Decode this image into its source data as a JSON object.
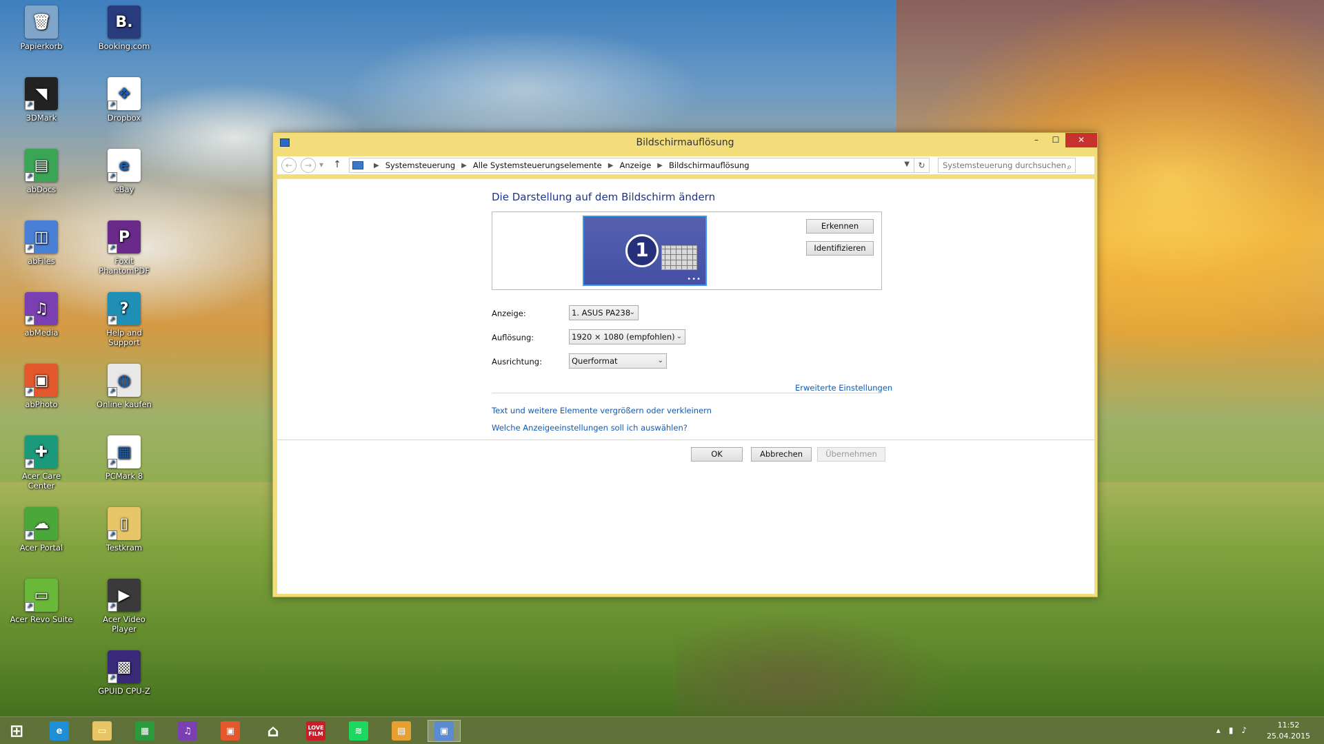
{
  "desktop": {
    "icons": [
      {
        "label": "Papierkorb",
        "icon": "recycle-bin-icon",
        "color": "#7fa5c8"
      },
      {
        "label": "Booking.com",
        "icon": "booking-icon",
        "color": "#273b7d"
      },
      {
        "label": "3DMark",
        "icon": "3dmark-icon",
        "color": "#222222"
      },
      {
        "label": "Dropbox",
        "icon": "dropbox-icon",
        "color": "#ffffff"
      },
      {
        "label": "abDocs",
        "icon": "abdocs-icon",
        "color": "#3aa655"
      },
      {
        "label": "eBay",
        "icon": "ebay-icon",
        "color": "#ffffff"
      },
      {
        "label": "abFiles",
        "icon": "abfiles-icon",
        "color": "#4a7fd6"
      },
      {
        "label": "Foxit PhantomPDF",
        "icon": "foxit-icon",
        "color": "#6a2a8a"
      },
      {
        "label": "abMedia",
        "icon": "abmedia-icon",
        "color": "#7a3fb0"
      },
      {
        "label": "Help and Support",
        "icon": "help-icon",
        "color": "#1f8fb5"
      },
      {
        "label": "abPhoto",
        "icon": "abphoto-icon",
        "color": "#e2572b"
      },
      {
        "label": "Online kaufen",
        "icon": "acer-store-icon",
        "color": "#e8e8e8"
      },
      {
        "label": "Acer Care Center",
        "icon": "care-center-icon",
        "color": "#1a9a7a"
      },
      {
        "label": "PCMark 8",
        "icon": "pcmark-icon",
        "color": "#ffffff"
      },
      {
        "label": "Acer Portal",
        "icon": "acer-portal-icon",
        "color": "#4aa83a"
      },
      {
        "label": "Testkram",
        "icon": "folder-icon",
        "color": "#e8c668"
      },
      {
        "label": "Acer Revo Suite",
        "icon": "revo-suite-icon",
        "color": "#6ab83a"
      },
      {
        "label": "Acer Video Player",
        "icon": "video-player-icon",
        "color": "#3a3a3a"
      },
      {
        "label": "GPUID CPU-Z",
        "icon": "cpuz-icon",
        "color": "#3a2a7a"
      }
    ]
  },
  "window": {
    "title": "Bildschirmauflösung",
    "controls": {
      "minimize": "–",
      "maximize": "☐",
      "close": "✕"
    },
    "address": {
      "crumbs": [
        "Systemsteuerung",
        "Alle Systemsteuerungselemente",
        "Anzeige",
        "Bildschirmauflösung"
      ],
      "search_placeholder": "Systemsteuerung durchsuchen"
    },
    "heading": "Die Darstellung auf dem Bildschirm ändern",
    "monitor_number": "1",
    "buttons": {
      "detect": "Erkennen",
      "identify": "Identifizieren",
      "ok": "OK",
      "cancel": "Abbrechen",
      "apply": "Übernehmen"
    },
    "fields": {
      "display_label": "Anzeige:",
      "display_value": "1. ASUS PA238",
      "resolution_label": "Auflösung:",
      "resolution_value": "1920 × 1080 (empfohlen)",
      "orientation_label": "Ausrichtung:",
      "orientation_value": "Querformat"
    },
    "links": {
      "advanced": "Erweiterte Einstellungen",
      "text_size": "Text und weitere Elemente vergrößern oder verkleinern",
      "which_settings": "Welche Anzeigeeinstellungen soll ich auswählen?"
    }
  },
  "taskbar": {
    "clock_time": "11:52",
    "clock_date": "25.04.2015",
    "apps": [
      {
        "icon": "windows-start-icon",
        "color": "#ffffff"
      },
      {
        "icon": "internet-explorer-icon",
        "color": "#1e8fd6"
      },
      {
        "icon": "file-explorer-icon",
        "color": "#e8c668"
      },
      {
        "icon": "store-icon",
        "color": "#2a9a3a"
      },
      {
        "icon": "abmedia-icon",
        "color": "#7a3fb0"
      },
      {
        "icon": "abphoto-icon",
        "color": "#e2572b"
      },
      {
        "icon": "home-icon",
        "color": "#ffffff"
      },
      {
        "icon": "lovefilm-icon",
        "color": "#c81e2a"
      },
      {
        "icon": "spotify-icon",
        "color": "#1ed760"
      },
      {
        "icon": "notes-icon",
        "color": "#e8a030"
      },
      {
        "icon": "display-settings-icon",
        "color": "#5a8ad0"
      }
    ],
    "lovefilm_label": "LOVE FILM"
  }
}
